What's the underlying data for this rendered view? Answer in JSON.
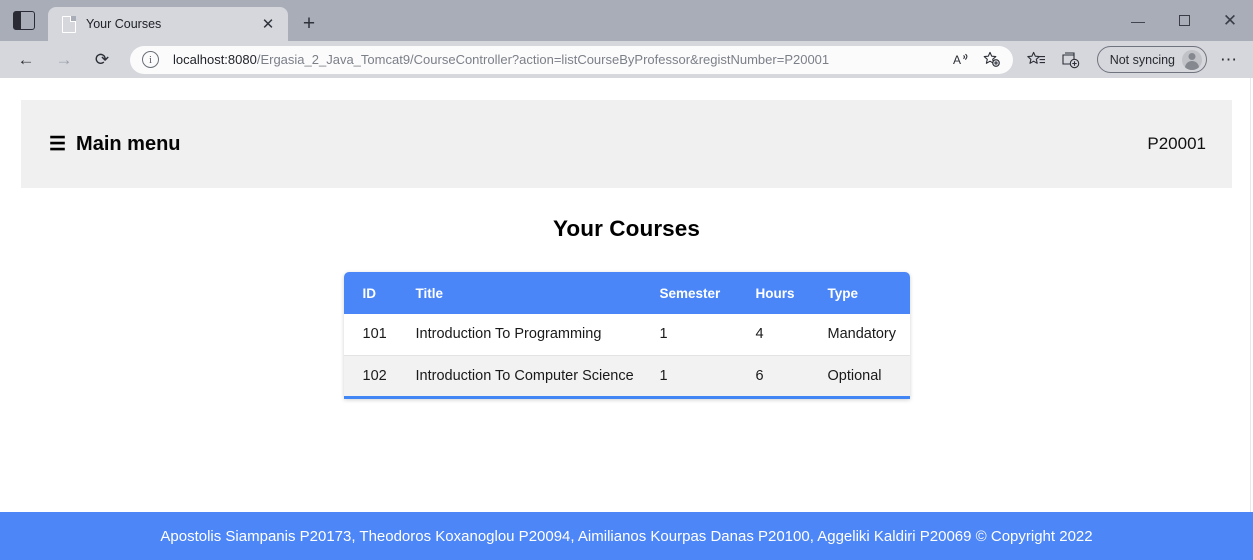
{
  "browser": {
    "tab": {
      "title": "Your Courses",
      "close_label": "✕",
      "favicon_name": "page-icon"
    },
    "new_tab_label": "+",
    "tab_list_icon": "tab-list-icon",
    "window_controls": {
      "minimize": "—",
      "maximize": "",
      "close": "✕"
    },
    "toolbar": {
      "back": "←",
      "forward": "→",
      "reload": "⟳",
      "url_host": "localhost:8080",
      "url_path": "/Ergasia_2_Java_Tomcat9/CourseController?action=listCourseByProfessor&registNumber=P20001",
      "info_icon": "i",
      "read_aloud": "A",
      "add_favorite": "☆",
      "favorites": "☆",
      "collections": "⧉",
      "profile_label": "Not syncing",
      "settings_more": "⋯"
    }
  },
  "page": {
    "navbar": {
      "menu_icon": "☰",
      "brand": "Main menu",
      "regist_number": "P20001"
    },
    "title": "Your Courses",
    "table": {
      "columns": [
        "ID",
        "Title",
        "Semester",
        "Hours",
        "Type"
      ],
      "rows": [
        {
          "id": "101",
          "title": "Introduction To Programming",
          "semester": "1",
          "hours": "4",
          "type": "Mandatory"
        },
        {
          "id": "102",
          "title": "Introduction To Computer Science",
          "semester": "1",
          "hours": "6",
          "type": "Optional"
        }
      ]
    },
    "footer": "Apostolis Siampanis P20173, Theodoros Koxanoglou P20094, Aimilianos Kourpas Danas P20100, Aggeliki Kaldiri P20069 © Copyright 2022"
  },
  "colors": {
    "accent_blue": "#4a86f7",
    "footer_blue": "#4d86f7",
    "navbar_gray": "#f0f0f0",
    "row_alt_gray": "#f2f2f2"
  }
}
